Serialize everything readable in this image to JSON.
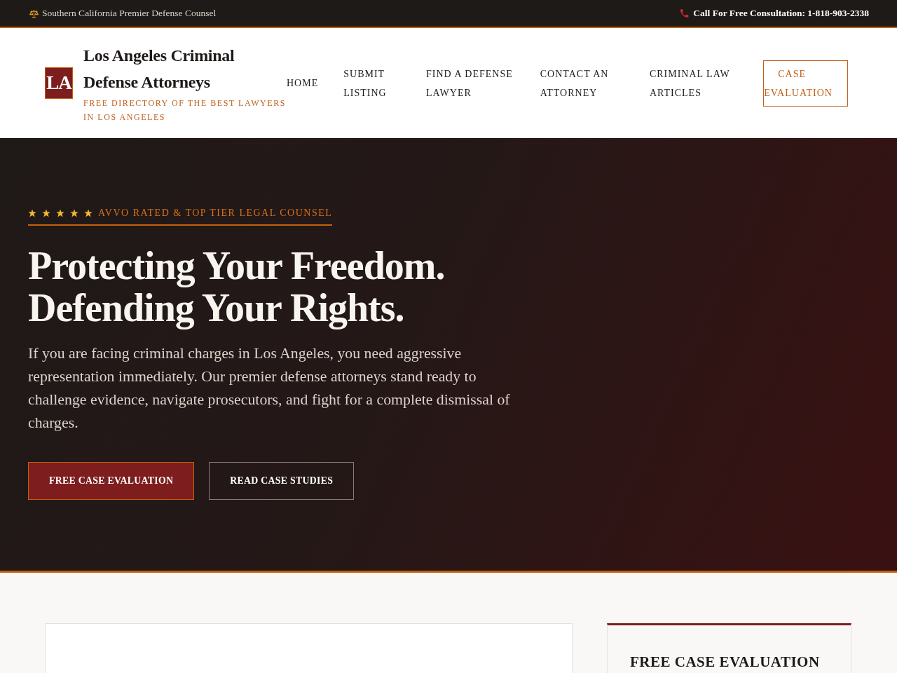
{
  "top_bar": {
    "tagline": "Southern California Premier Defense Counsel",
    "phone": "Call For Free Consultation: 1-818-903-2338"
  },
  "header": {
    "logo": "LA",
    "title": "Los Angeles Criminal Defense Attorneys",
    "subtitle": "FREE DIRECTORY OF THE BEST LAWYERS IN LOS ANGELES"
  },
  "nav": [
    {
      "label": "HOME",
      "kind": "link"
    },
    {
      "label": "SUBMIT LISTING",
      "kind": "link"
    },
    {
      "label": "FIND A DEFENSE LAWYER",
      "kind": "link"
    },
    {
      "label": "CONTACT AN ATTORNEY",
      "kind": "link"
    },
    {
      "label": "CRIMINAL LAW ARTICLES",
      "kind": "link"
    },
    {
      "label": "CASE EVALUATION",
      "kind": "cta"
    }
  ],
  "hero": {
    "badge": {
      "stars": 5,
      "text": "AVVO RATED & TOP TIER LEGAL COUNSEL"
    },
    "headline": [
      "Protecting Your Freedom.",
      "Defending Your Rights."
    ],
    "intro": "If you are facing criminal charges in Los Angeles, you need aggressive representation immediately. Our premier defense attorneys stand ready to challenge evidence, navigate prosecutors, and fight for a complete dismissal of charges.",
    "buttons": [
      {
        "label": "FREE CASE EVALUATION",
        "kind": "primary"
      },
      {
        "label": "READ CASE STUDIES",
        "kind": "outline"
      }
    ]
  },
  "main": {
    "sidebar": {
      "title": "FREE CASE EVALUATION"
    }
  }
}
